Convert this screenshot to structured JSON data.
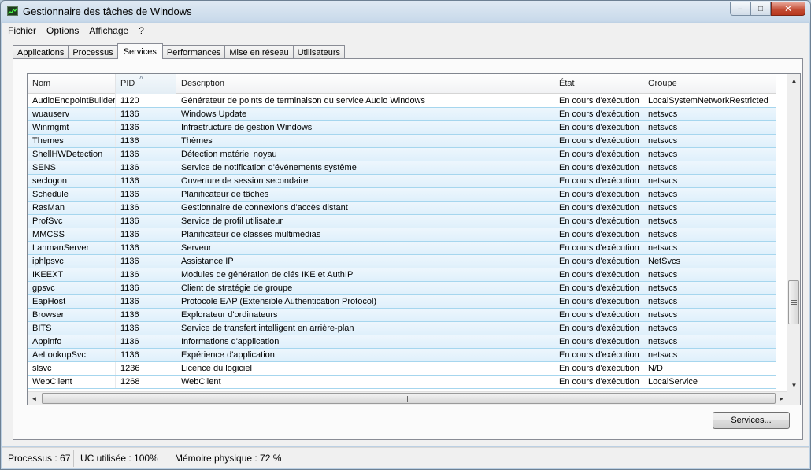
{
  "window": {
    "title": "Gestionnaire des tâches de Windows",
    "minimize_glyph": "‒",
    "maximize_glyph": "□",
    "close_glyph": "✕"
  },
  "menu": [
    "Fichier",
    "Options",
    "Affichage",
    "?"
  ],
  "tabs": [
    {
      "label": "Applications",
      "active": false
    },
    {
      "label": "Processus",
      "active": false
    },
    {
      "label": "Services",
      "active": true
    },
    {
      "label": "Performances",
      "active": false
    },
    {
      "label": "Mise en réseau",
      "active": false
    },
    {
      "label": "Utilisateurs",
      "active": false
    }
  ],
  "table": {
    "columns": [
      "Nom",
      "PID",
      "Description",
      "État",
      "Groupe"
    ],
    "sorted_column": "PID",
    "rows": [
      {
        "name": "AudioEndpointBuilder",
        "pid": "1120",
        "desc": "Générateur de points de terminaison du service Audio Windows",
        "state": "En cours d'exécution",
        "group": "LocalSystemNetworkRestricted",
        "selected": false
      },
      {
        "name": "wuauserv",
        "pid": "1136",
        "desc": "Windows Update",
        "state": "En cours d'exécution",
        "group": "netsvcs",
        "selected": true
      },
      {
        "name": "Winmgmt",
        "pid": "1136",
        "desc": "Infrastructure de gestion Windows",
        "state": "En cours d'exécution",
        "group": "netsvcs",
        "selected": true
      },
      {
        "name": "Themes",
        "pid": "1136",
        "desc": "Thèmes",
        "state": "En cours d'exécution",
        "group": "netsvcs",
        "selected": true
      },
      {
        "name": "ShellHWDetection",
        "pid": "1136",
        "desc": "Détection matériel noyau",
        "state": "En cours d'exécution",
        "group": "netsvcs",
        "selected": true
      },
      {
        "name": "SENS",
        "pid": "1136",
        "desc": "Service de notification d'événements système",
        "state": "En cours d'exécution",
        "group": "netsvcs",
        "selected": true
      },
      {
        "name": "seclogon",
        "pid": "1136",
        "desc": "Ouverture de session secondaire",
        "state": "En cours d'exécution",
        "group": "netsvcs",
        "selected": true
      },
      {
        "name": "Schedule",
        "pid": "1136",
        "desc": "Planificateur de tâches",
        "state": "En cours d'exécution",
        "group": "netsvcs",
        "selected": true
      },
      {
        "name": "RasMan",
        "pid": "1136",
        "desc": "Gestionnaire de connexions d'accès distant",
        "state": "En cours d'exécution",
        "group": "netsvcs",
        "selected": true
      },
      {
        "name": "ProfSvc",
        "pid": "1136",
        "desc": "Service de profil utilisateur",
        "state": "En cours d'exécution",
        "group": "netsvcs",
        "selected": true
      },
      {
        "name": "MMCSS",
        "pid": "1136",
        "desc": "Planificateur de classes multimédias",
        "state": "En cours d'exécution",
        "group": "netsvcs",
        "selected": true
      },
      {
        "name": "LanmanServer",
        "pid": "1136",
        "desc": "Serveur",
        "state": "En cours d'exécution",
        "group": "netsvcs",
        "selected": true
      },
      {
        "name": "iphlpsvc",
        "pid": "1136",
        "desc": "Assistance IP",
        "state": "En cours d'exécution",
        "group": "NetSvcs",
        "selected": true
      },
      {
        "name": "IKEEXT",
        "pid": "1136",
        "desc": "Modules de génération de clés IKE et AuthIP",
        "state": "En cours d'exécution",
        "group": "netsvcs",
        "selected": true
      },
      {
        "name": "gpsvc",
        "pid": "1136",
        "desc": "Client de stratégie de groupe",
        "state": "En cours d'exécution",
        "group": "netsvcs",
        "selected": true
      },
      {
        "name": "EapHost",
        "pid": "1136",
        "desc": "Protocole EAP (Extensible Authentication Protocol)",
        "state": "En cours d'exécution",
        "group": "netsvcs",
        "selected": true
      },
      {
        "name": "Browser",
        "pid": "1136",
        "desc": "Explorateur d'ordinateurs",
        "state": "En cours d'exécution",
        "group": "netsvcs",
        "selected": true
      },
      {
        "name": "BITS",
        "pid": "1136",
        "desc": "Service de transfert intelligent en arrière-plan",
        "state": "En cours d'exécution",
        "group": "netsvcs",
        "selected": true
      },
      {
        "name": "Appinfo",
        "pid": "1136",
        "desc": "Informations d'application",
        "state": "En cours d'exécution",
        "group": "netsvcs",
        "selected": true
      },
      {
        "name": "AeLookupSvc",
        "pid": "1136",
        "desc": "Expérience d'application",
        "state": "En cours d'exécution",
        "group": "netsvcs",
        "selected": true
      },
      {
        "name": "slsvc",
        "pid": "1236",
        "desc": "Licence du logiciel",
        "state": "En cours d'exécution",
        "group": "N/D",
        "selected": false
      },
      {
        "name": "WebClient",
        "pid": "1268",
        "desc": "WebClient",
        "state": "En cours d'exécution",
        "group": "LocalService",
        "selected": false
      }
    ]
  },
  "scroll_glyphs": {
    "up": "▲",
    "down": "▼",
    "left": "◄",
    "right": "►",
    "sort": "˄"
  },
  "services_button": "Services...",
  "status": {
    "processes": "Processus : 67",
    "cpu": "UC utilisée : 100%",
    "memory": "Mémoire physique : 72 %"
  }
}
